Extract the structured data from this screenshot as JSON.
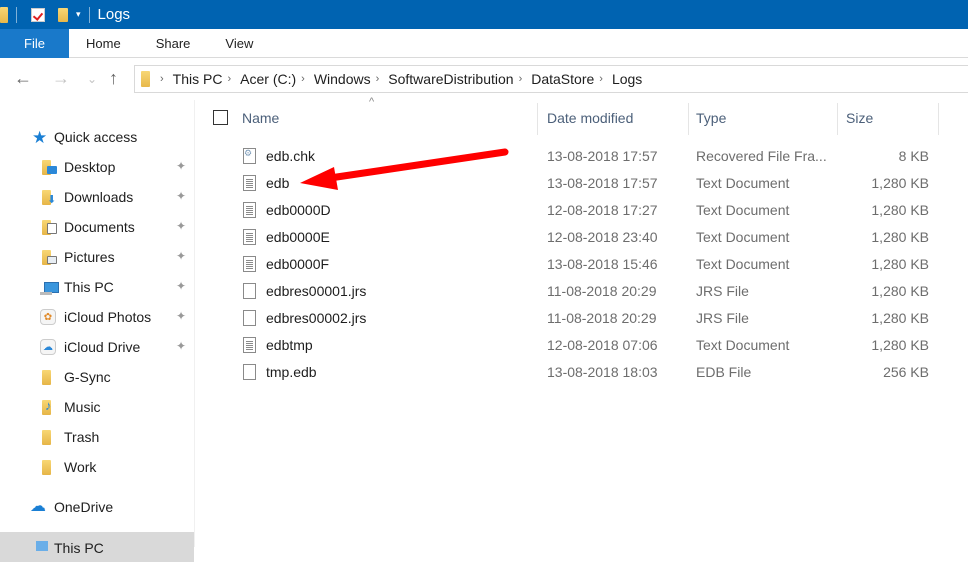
{
  "titlebar": {
    "title": "Logs",
    "quick_access_toolbar": [
      "folder-icon",
      "properties-icon",
      "new-folder-icon",
      "customize-dropdown-icon"
    ]
  },
  "ribbon": {
    "tabs": [
      {
        "label": "File",
        "active": true
      },
      {
        "label": "Home"
      },
      {
        "label": "Share"
      },
      {
        "label": "View"
      }
    ]
  },
  "navigation": {
    "back": "←",
    "forward": "→",
    "recent": "⌄",
    "up": "↑",
    "breadcrumb": [
      "This PC",
      "Acer (C:)",
      "Windows",
      "SoftwareDistribution",
      "DataStore",
      "Logs"
    ],
    "separator": "›"
  },
  "sidebar": {
    "items": [
      {
        "label": "Quick access",
        "icon": "star-icon",
        "pinned": false,
        "level": "top"
      },
      {
        "label": "Desktop",
        "icon": "desktop-folder-icon",
        "pinned": true
      },
      {
        "label": "Downloads",
        "icon": "downloads-folder-icon",
        "pinned": true
      },
      {
        "label": "Documents",
        "icon": "documents-folder-icon",
        "pinned": true
      },
      {
        "label": "Pictures",
        "icon": "pictures-folder-icon",
        "pinned": true
      },
      {
        "label": "This PC",
        "icon": "computer-icon",
        "pinned": true
      },
      {
        "label": "iCloud Photos",
        "icon": "icloud-photos-icon",
        "pinned": true
      },
      {
        "label": "iCloud Drive",
        "icon": "icloud-drive-icon",
        "pinned": true
      },
      {
        "label": "G-Sync",
        "icon": "folder-icon",
        "pinned": false
      },
      {
        "label": "Music",
        "icon": "music-folder-icon",
        "pinned": false
      },
      {
        "label": "Trash",
        "icon": "folder-icon",
        "pinned": false
      },
      {
        "label": "Work",
        "icon": "folder-icon",
        "pinned": false
      },
      {
        "label": "OneDrive",
        "icon": "onedrive-cloud-icon",
        "pinned": false,
        "level": "top"
      },
      {
        "label": "This PC",
        "icon": "computer-icon",
        "pinned": false,
        "level": "top",
        "selected": true
      }
    ],
    "pin_glyph": "📌"
  },
  "file_list": {
    "sort_indicator": "^",
    "columns": [
      "Name",
      "Date modified",
      "Type",
      "Size"
    ],
    "rows": [
      {
        "name": "edb.chk",
        "date": "13-08-2018 17:57",
        "type": "Recovered File Fra...",
        "size": "8 KB",
        "icon": "gear-doc"
      },
      {
        "name": "edb",
        "date": "13-08-2018 17:57",
        "type": "Text Document",
        "size": "1,280 KB",
        "icon": "text-doc"
      },
      {
        "name": "edb0000D",
        "date": "12-08-2018 17:27",
        "type": "Text Document",
        "size": "1,280 KB",
        "icon": "text-doc"
      },
      {
        "name": "edb0000E",
        "date": "12-08-2018 23:40",
        "type": "Text Document",
        "size": "1,280 KB",
        "icon": "text-doc"
      },
      {
        "name": "edb0000F",
        "date": "13-08-2018 15:46",
        "type": "Text Document",
        "size": "1,280 KB",
        "icon": "text-doc"
      },
      {
        "name": "edbres00001.jrs",
        "date": "11-08-2018 20:29",
        "type": "JRS File",
        "size": "1,280 KB",
        "icon": "blank-doc"
      },
      {
        "name": "edbres00002.jrs",
        "date": "11-08-2018 20:29",
        "type": "JRS File",
        "size": "1,280 KB",
        "icon": "blank-doc"
      },
      {
        "name": "edbtmp",
        "date": "12-08-2018 07:06",
        "type": "Text Document",
        "size": "1,280 KB",
        "icon": "text-doc"
      },
      {
        "name": "tmp.edb",
        "date": "13-08-2018 18:03",
        "type": "EDB File",
        "size": "256 KB",
        "icon": "blank-doc"
      }
    ]
  },
  "annotation": {
    "type": "red-arrow",
    "points_to": "edb",
    "color": "#ff0000"
  },
  "colors": {
    "titlebar": "#0063b1",
    "file_tab": "#1979ca",
    "header_text": "#4c607a",
    "selected_bg": "#d9d9d9"
  }
}
